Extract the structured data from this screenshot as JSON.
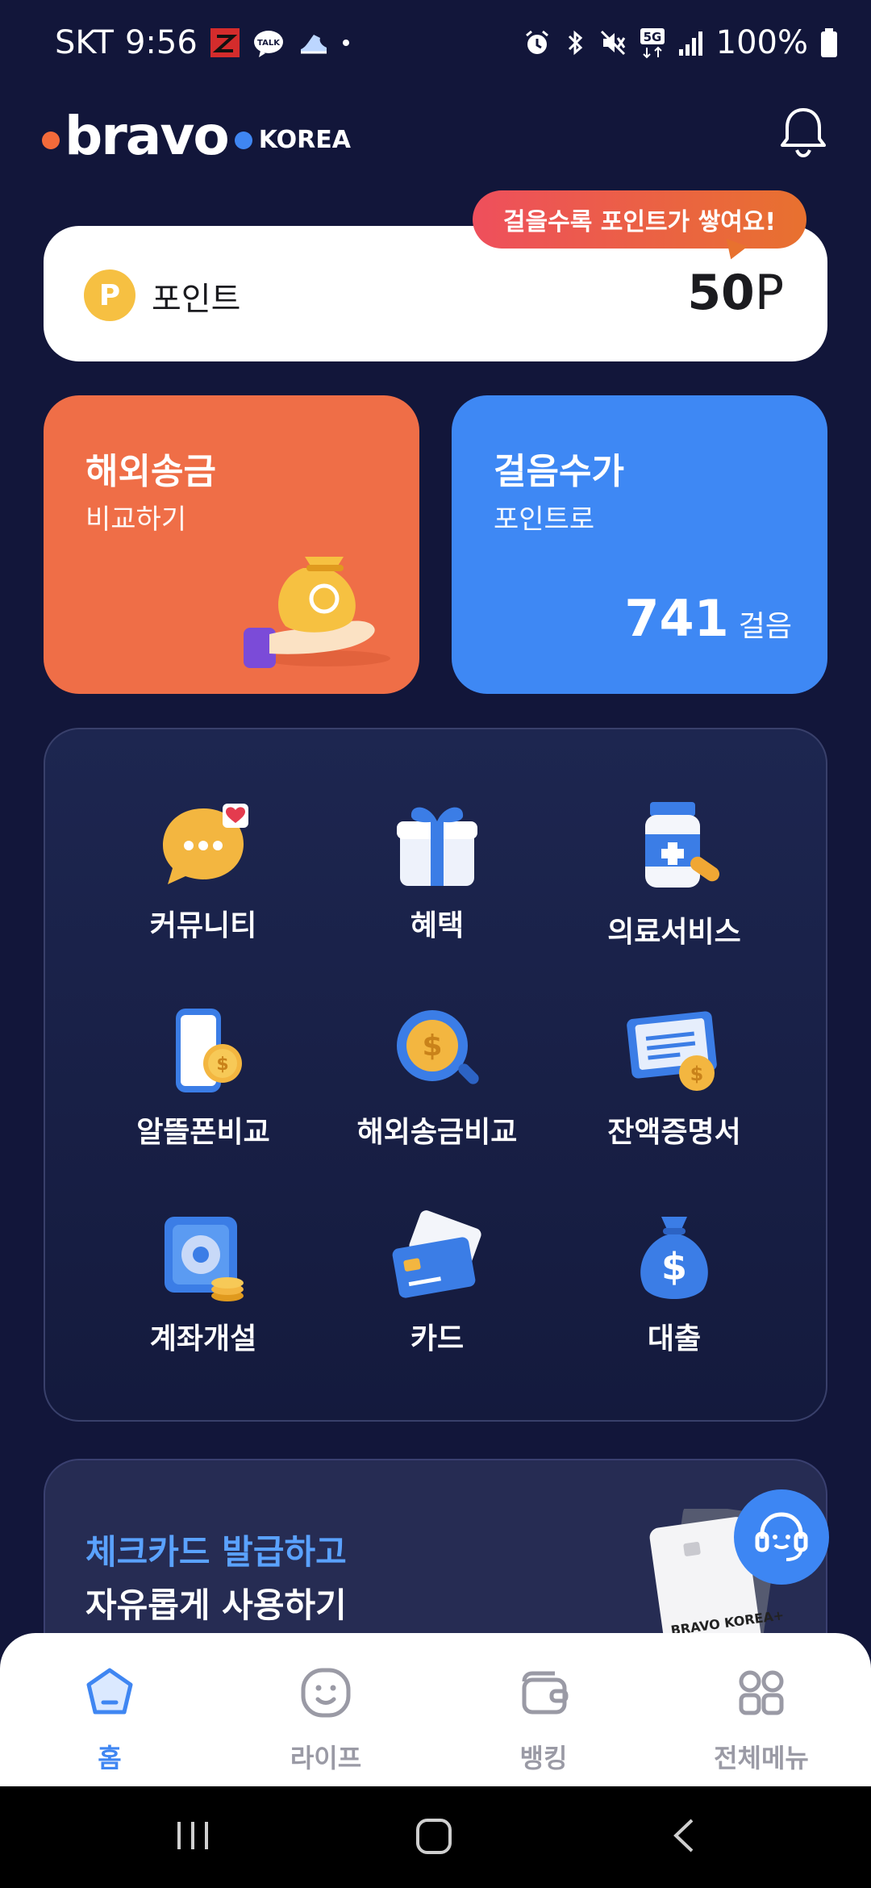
{
  "status": {
    "carrier": "SKT",
    "time": "9:56",
    "battery": "100%",
    "icons": [
      "app-z-icon",
      "kakaotalk-icon",
      "shoe-icon",
      "dot-icon",
      "alarm-icon",
      "bluetooth-icon",
      "mute-icon",
      "5g-icon",
      "signal-icon",
      "battery-icon"
    ],
    "talk": "TALK",
    "network": "5G"
  },
  "header": {
    "logo_word": "bravo",
    "logo_suffix": "KOREA",
    "bell_icon": "bell-icon"
  },
  "points": {
    "tooltip": "걸을수록 포인트가 쌓여요!",
    "badge": "P",
    "label": "포인트",
    "value": "50",
    "unit": "P"
  },
  "cards": {
    "remit": {
      "title": "해외송금",
      "subtitle": "비교하기",
      "icon": "money-bag-hand-icon"
    },
    "steps": {
      "title": "걸음수가",
      "subtitle": "포인트로",
      "count": "741",
      "unit": "걸음"
    }
  },
  "menu": [
    {
      "label": "커뮤니티",
      "icon": "chat-bubble-icon"
    },
    {
      "label": "혜택",
      "icon": "gift-icon"
    },
    {
      "label": "의료서비스",
      "icon": "medicine-bottle-icon"
    },
    {
      "label": "알뜰폰비교",
      "icon": "phone-coin-icon"
    },
    {
      "label": "해외송금비교",
      "icon": "coin-search-icon"
    },
    {
      "label": "잔액증명서",
      "icon": "certificate-icon"
    },
    {
      "label": "계좌개설",
      "icon": "safe-icon"
    },
    {
      "label": "카드",
      "icon": "credit-card-icon"
    },
    {
      "label": "대출",
      "icon": "money-bag-icon"
    }
  ],
  "promo": {
    "line1": "체크카드 발급하고",
    "line2": "자유롭게 사용하기",
    "card_text": "BRAVO KOREA+"
  },
  "fab": {
    "icon": "headset-support-icon"
  },
  "bottom_nav": [
    {
      "label": "홈",
      "icon": "home-icon",
      "active": true
    },
    {
      "label": "라이프",
      "icon": "smile-icon",
      "active": false
    },
    {
      "label": "뱅킹",
      "icon": "wallet-icon",
      "active": false
    },
    {
      "label": "전체메뉴",
      "icon": "grid-menu-icon",
      "active": false
    }
  ],
  "colors": {
    "background": "#12163a",
    "orange": "#ef6e47",
    "blue": "#3e88f4",
    "accent_blue_text": "#5aa2ff"
  }
}
